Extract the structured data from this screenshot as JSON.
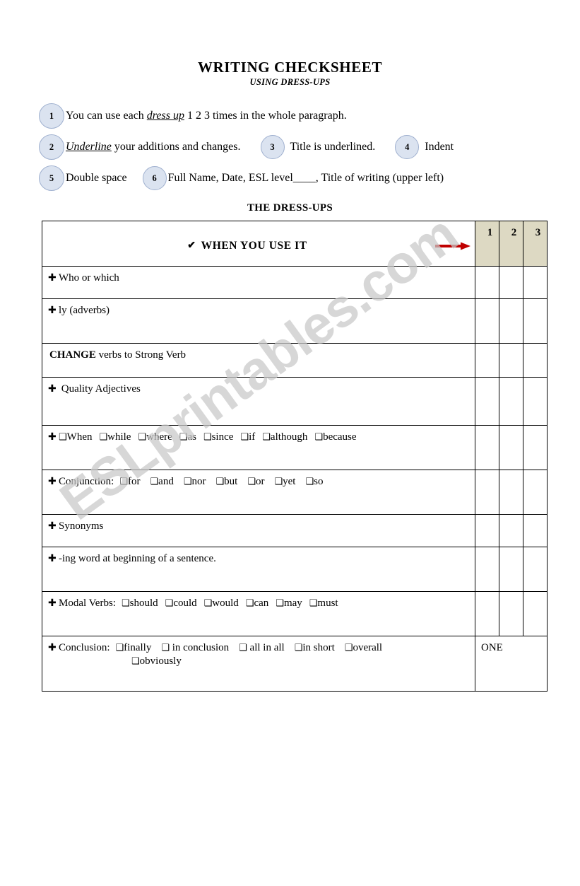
{
  "document": {
    "title": "WRITING CHECKSHEET",
    "subtitle": "USING DRESS-UPS",
    "section_heading": "THE DRESS-UPS",
    "watermark": "ESLprintables.com"
  },
  "instructions": [
    {
      "number": "1",
      "text_before": "You can use each ",
      "emphasis": "dress up",
      "text_after": " 1 2 3 times in the whole paragraph."
    },
    {
      "number": "2",
      "emphasis": "Underline",
      "text_after": " your additions and changes."
    },
    {
      "number": "3",
      "text": "Title is underlined."
    },
    {
      "number": "4",
      "text": "Indent"
    },
    {
      "number": "5",
      "text": "Double space"
    },
    {
      "number": "6",
      "text": "Full Name, Date, ESL level____, Title of writing (upper left)"
    }
  ],
  "table": {
    "header": {
      "check_icon": "✔",
      "label": "WHEN YOU USE IT",
      "arrow_icon": "right-arrow",
      "arrow_color": "#C00000",
      "columns": [
        "1",
        "2",
        "3"
      ],
      "column_bg": "#DDD9C3"
    },
    "bullet_glyph": "✚",
    "checkbox_glyph": "❑",
    "rows": [
      {
        "id": "who-or-which",
        "label": "Who or which",
        "bulleted": true,
        "options": []
      },
      {
        "id": "ly-adverbs",
        "label": "ly   (adverbs)",
        "bulleted": true,
        "options": []
      },
      {
        "id": "change-verbs",
        "label_strong": "CHANGE",
        "label": "  verbs to Strong Verb",
        "bulleted": false,
        "options": []
      },
      {
        "id": "quality-adjectives",
        "label": " Quality Adjectives",
        "bulleted": true,
        "options": []
      },
      {
        "id": "www-asia-b",
        "label": "",
        "bulleted": true,
        "options": [
          "When",
          "while",
          "where",
          "as",
          "since",
          "if",
          "although",
          "because"
        ]
      },
      {
        "id": "conjunction",
        "label": "Conjunction:",
        "bulleted": true,
        "options": [
          "for",
          "and",
          "nor",
          "but",
          "or",
          "yet",
          "so"
        ]
      },
      {
        "id": "synonyms",
        "label": "Synonyms",
        "bulleted": true,
        "options": []
      },
      {
        "id": "ing-word",
        "label": "-ing word at beginning of a sentence.",
        "bulleted": true,
        "options": []
      },
      {
        "id": "modal-verbs",
        "label": "Modal Verbs:",
        "bulleted": true,
        "options": [
          "should",
          "could",
          "would",
          "can",
          "may",
          "must"
        ]
      },
      {
        "id": "conclusion",
        "label": "Conclusion:",
        "bulleted": true,
        "options": [
          "finally",
          " in conclusion",
          " all in all",
          "in short",
          "overall"
        ],
        "options_line2": [
          "obviously"
        ],
        "merged_value": "ONE"
      }
    ]
  }
}
